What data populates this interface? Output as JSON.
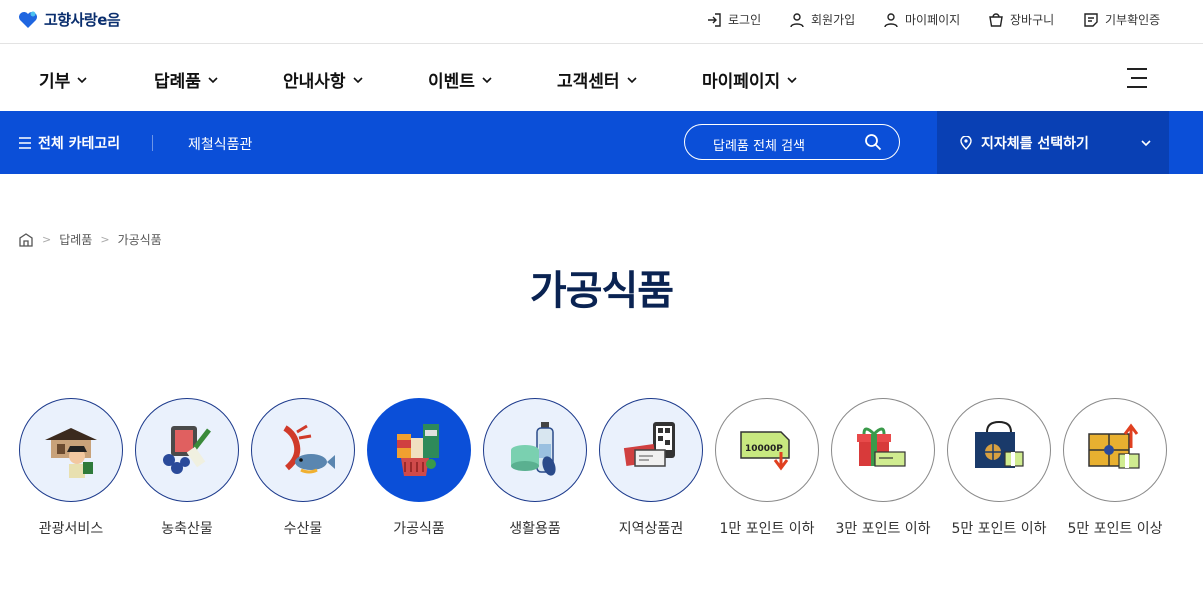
{
  "brand": {
    "logo_text": "고향사랑e음"
  },
  "utility": [
    {
      "label": "로그인",
      "icon": "login-icon"
    },
    {
      "label": "회원가입",
      "icon": "user-icon"
    },
    {
      "label": "마이페이지",
      "icon": "user-icon"
    },
    {
      "label": "장바구니",
      "icon": "cart-icon"
    },
    {
      "label": "기부확인증",
      "icon": "certificate-icon"
    }
  ],
  "nav": [
    "기부",
    "답례품",
    "안내사항",
    "이벤트",
    "고객센터",
    "마이페이지"
  ],
  "subbar": {
    "all_category": "전체 카테고리",
    "current_sub": "제철식품관",
    "search_placeholder": "답례품 전체 검색",
    "region_select": "지자체를 선택하기"
  },
  "breadcrumb": [
    "답례품",
    "가공식품"
  ],
  "page_title": "가공식품",
  "categories": [
    {
      "label": "관광서비스",
      "style": "blue"
    },
    {
      "label": "농축산물",
      "style": "blue"
    },
    {
      "label": "수산물",
      "style": "blue"
    },
    {
      "label": "가공식품",
      "style": "active"
    },
    {
      "label": "생활용품",
      "style": "blue"
    },
    {
      "label": "지역상품권",
      "style": "blue"
    },
    {
      "label": "1만 포인트 이하",
      "style": "white"
    },
    {
      "label": "3만 포인트 이하",
      "style": "white"
    },
    {
      "label": "5만 포인트 이하",
      "style": "white"
    },
    {
      "label": "5만 포인트 이상",
      "style": "white"
    }
  ],
  "colors": {
    "primary": "#0b4fd8",
    "region_bg": "#0940b4",
    "title": "#0a2352"
  }
}
